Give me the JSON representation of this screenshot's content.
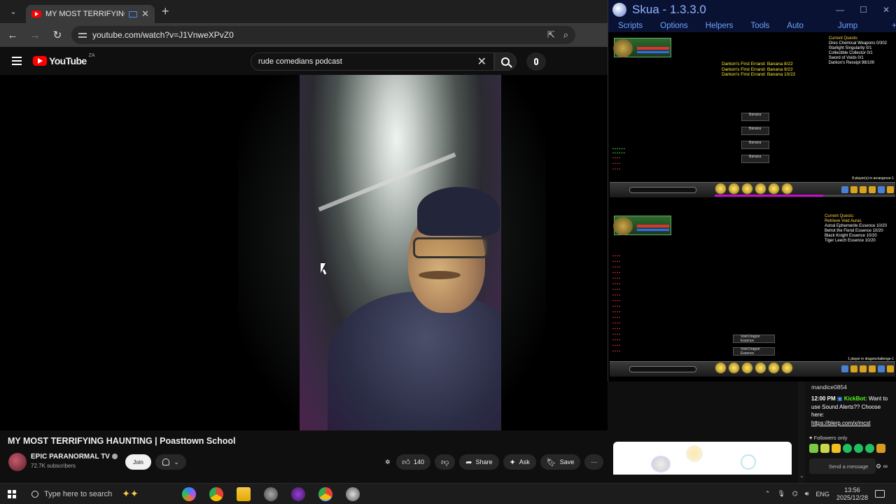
{
  "browser": {
    "tab_title": "MY MOST TERRIFYING HAU",
    "url": "youtube.com/watch?v=J1VnweXPvZ0",
    "new_tab": "+",
    "tab_close": "✕"
  },
  "youtube": {
    "logo_text": "YouTube",
    "country_code": "ZA",
    "search_query": "rude comedians podcast",
    "clear_glyph": "✕"
  },
  "video": {
    "title": "MY MOST TERRIFYING HAUNTING | Poasttown School",
    "channel": "EPIC PARANORMAL TV",
    "subscribers": "72.7K subscribers",
    "join_label": "Join",
    "likes": "140",
    "share_label": "Share",
    "ask_label": "Ask",
    "save_label": "Save",
    "more_label": "⋯"
  },
  "skua": {
    "title": "Skua - 1.3.3.0",
    "menu": [
      "Scripts",
      "Options",
      "Helpers",
      "Tools"
    ],
    "menu_right": [
      "Auto",
      "Jump"
    ],
    "pane_a": {
      "quests_header": "Current Quests:",
      "quests": [
        "Ores Chemical Weapons 0/302",
        "Starlight Singularity 0/1",
        "Collectible Collector 0/1",
        "Sword of Voids 0/1",
        "Darkon's Receipt 98/100"
      ],
      "progress": [
        "Darkon's First Errand: Banana 8/22",
        "Darkon's First Errand: Banana 9/22",
        "Darkon's First Errand: Banana 10/22"
      ],
      "drops": [
        "Banana",
        "Banana",
        "Banana",
        "Banana"
      ],
      "players": "8 player(s) in arcangrove-1"
    },
    "pane_b": {
      "quests_header": "Current Quests:",
      "quests": [
        "Retrieve Void Auras",
        "Astral Ephemerite Essence 10/20",
        "Belrot the Fiend Essence 10/20",
        "Black Knight Essence 10/20",
        "Tiger Leech Essence 10/20"
      ],
      "drops": [
        "Void Dragon Essence",
        "Void Dragon Essence"
      ],
      "players": "1 player in dragonchallenge-1"
    }
  },
  "stream_chat": {
    "username": "mandice0854",
    "time": "12:00 PM",
    "bot": "KickBot:",
    "message": "Want to use Sound Alerts?? Choose here:",
    "link": "https://blerp.com/x/mcst",
    "followers_only": "Followers only",
    "send_placeholder": "Send a message"
  },
  "taskbar": {
    "search_placeholder": "Type here to search",
    "language": "ENG",
    "time": "13:56",
    "date": "2025/12/28"
  }
}
